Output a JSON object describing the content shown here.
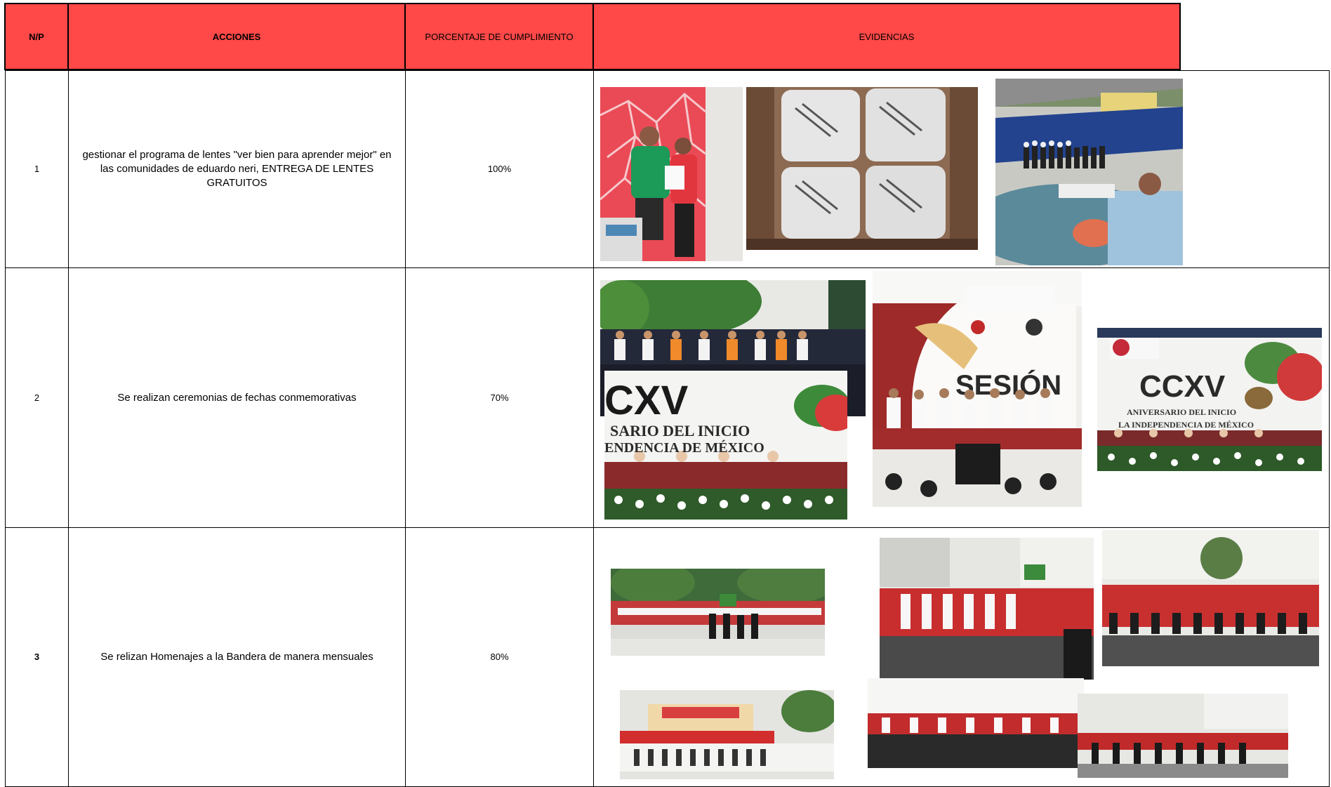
{
  "headers": {
    "np": "N/P",
    "acciones": "ACCIONES",
    "porcentaje": "PORCENTAJE DE CUMPLIMIENTO",
    "evidencias": "EVIDENCIAS"
  },
  "rows": [
    {
      "np": "1",
      "accion": "gestionar el programa de lentes \"ver bien para aprender mejor\" en las comunidades de eduardo neri, ENTREGA DE LENTES GRATUITOS",
      "porcentaje": "100%"
    },
    {
      "np": "2",
      "accion": "Se realizan ceremonias de fechas conmemorativas",
      "porcentaje": "70%"
    },
    {
      "np": "3",
      "accion": "Se relizan Homenajes a la Bandera de manera mensuales",
      "porcentaje": "80%"
    }
  ],
  "photo_text": {
    "ccxv": "CCXV",
    "cxv": "CXV",
    "sesion": "SESIÓN",
    "aniversario": "SARIO DEL INICIO",
    "independencia": "ENDENCIA DE MÉXICO",
    "aniv_small": "ANIVERSARIO DEL INICIO",
    "indep_small": "LA INDEPENDENCIA DE MÉXICO"
  },
  "colors": {
    "header_bg": "#ff4848",
    "border": "#000000"
  }
}
